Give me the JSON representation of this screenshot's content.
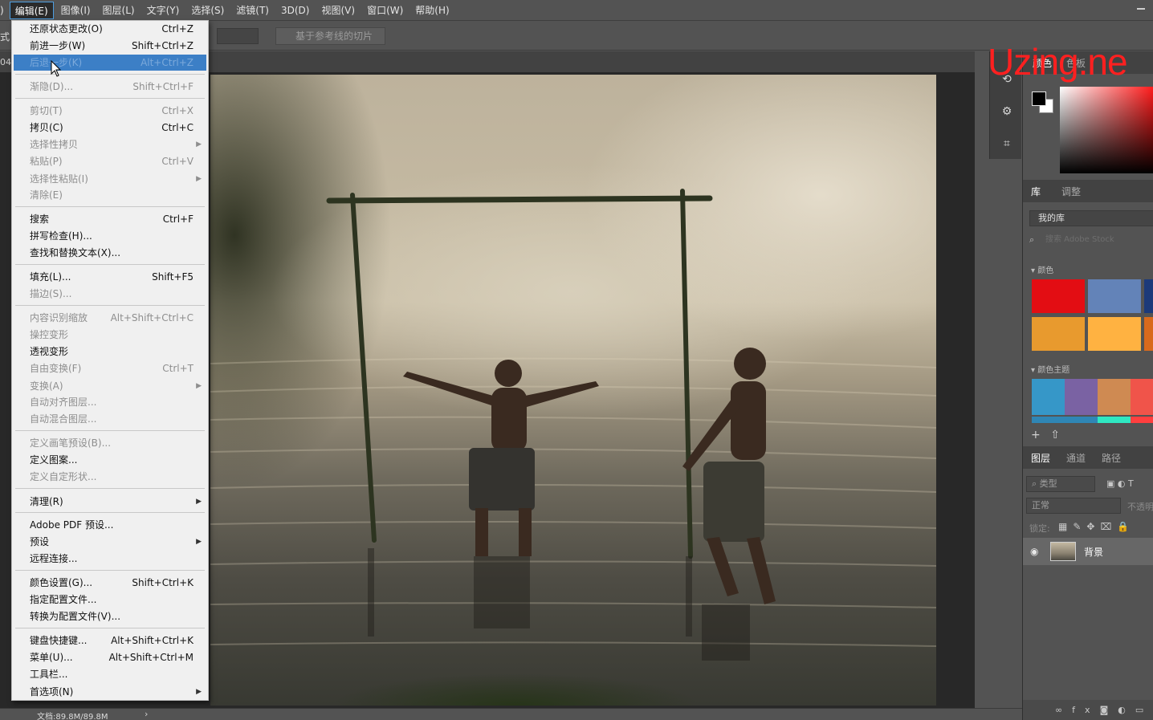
{
  "menubar": {
    "items": [
      {
        "label": ")"
      },
      {
        "label": "编辑(E)"
      },
      {
        "label": "图像(I)"
      },
      {
        "label": "图层(L)"
      },
      {
        "label": "文字(Y)"
      },
      {
        "label": "选择(S)"
      },
      {
        "label": "滤镜(T)"
      },
      {
        "label": "3D(D)"
      },
      {
        "label": "视图(V)"
      },
      {
        "label": "窗口(W)"
      },
      {
        "label": "帮助(H)"
      }
    ]
  },
  "options": {
    "style_fragment": "式",
    "slices_button": "基于参考线的切片"
  },
  "document": {
    "tab_fragment": "04"
  },
  "edit_menu": {
    "items": [
      {
        "label": "还原状态更改(O)",
        "shortcut": "Ctrl+Z"
      },
      {
        "label": "前进一步(W)",
        "shortcut": "Shift+Ctrl+Z"
      },
      {
        "label": "后退一步(K)",
        "shortcut": "Alt+Ctrl+Z"
      },
      {
        "label": "渐隐(D)...",
        "shortcut": "Shift+Ctrl+F"
      },
      {
        "label": "剪切(T)",
        "shortcut": "Ctrl+X"
      },
      {
        "label": "拷贝(C)",
        "shortcut": "Ctrl+C"
      },
      {
        "label": "选择性拷贝",
        "shortcut": ""
      },
      {
        "label": "粘贴(P)",
        "shortcut": "Ctrl+V"
      },
      {
        "label": "选择性粘贴(I)",
        "shortcut": ""
      },
      {
        "label": "清除(E)",
        "shortcut": ""
      },
      {
        "label": "搜索",
        "shortcut": "Ctrl+F"
      },
      {
        "label": "拼写检查(H)...",
        "shortcut": ""
      },
      {
        "label": "查找和替换文本(X)...",
        "shortcut": ""
      },
      {
        "label": "填充(L)...",
        "shortcut": "Shift+F5"
      },
      {
        "label": "描边(S)...",
        "shortcut": ""
      },
      {
        "label": "内容识别缩放",
        "shortcut": "Alt+Shift+Ctrl+C"
      },
      {
        "label": "操控变形",
        "shortcut": ""
      },
      {
        "label": "透视变形",
        "shortcut": ""
      },
      {
        "label": "自由变换(F)",
        "shortcut": "Ctrl+T"
      },
      {
        "label": "变换(A)",
        "shortcut": ""
      },
      {
        "label": "自动对齐图层...",
        "shortcut": ""
      },
      {
        "label": "自动混合图层...",
        "shortcut": ""
      },
      {
        "label": "定义画笔预设(B)...",
        "shortcut": ""
      },
      {
        "label": "定义图案...",
        "shortcut": ""
      },
      {
        "label": "定义自定形状...",
        "shortcut": ""
      },
      {
        "label": "清理(R)",
        "shortcut": ""
      },
      {
        "label": "Adobe PDF 预设...",
        "shortcut": ""
      },
      {
        "label": "预设",
        "shortcut": ""
      },
      {
        "label": "远程连接...",
        "shortcut": ""
      },
      {
        "label": "颜色设置(G)...",
        "shortcut": "Shift+Ctrl+K"
      },
      {
        "label": "指定配置文件...",
        "shortcut": ""
      },
      {
        "label": "转换为配置文件(V)...",
        "shortcut": ""
      },
      {
        "label": "键盘快捷键...",
        "shortcut": "Alt+Shift+Ctrl+K"
      },
      {
        "label": "菜单(U)...",
        "shortcut": "Alt+Shift+Ctrl+M"
      },
      {
        "label": "工具栏...",
        "shortcut": ""
      },
      {
        "label": "首选项(N)",
        "shortcut": ""
      }
    ]
  },
  "panel": {
    "top_tabs": [
      "颜色",
      "色板"
    ],
    "library_tabs": [
      "库",
      "调整"
    ],
    "library_name": "我的库",
    "library_search_placeholder": "搜索 Adobe Stock",
    "colors_section": "颜色",
    "themes_section": "颜色主题",
    "layer_tabs": [
      "图层",
      "通道",
      "路径"
    ],
    "layer_search_placeholder": "类型",
    "blend_mode": "正常",
    "opacity_label": "不透明",
    "lock_label": "锁定:",
    "layer_name": "背景",
    "swatch_colors": [
      "#e30d13",
      "#6383b8",
      "#1c3a7a",
      "#e89a2e",
      "#ffb241",
      "#d96a1c"
    ],
    "theme_colors": [
      "#3697c8",
      "#7a62a3",
      "#cf8a52",
      "#f0544a"
    ],
    "theme_strip_colors": [
      "#2f86b5",
      "#2f86b5",
      "#2fe8c2",
      "#ff3f3f"
    ]
  },
  "status": {
    "doc_size": "文档:89.8M/89.8M",
    "arrow": "›"
  },
  "watermark": {
    "text": "Uzing.ne"
  }
}
